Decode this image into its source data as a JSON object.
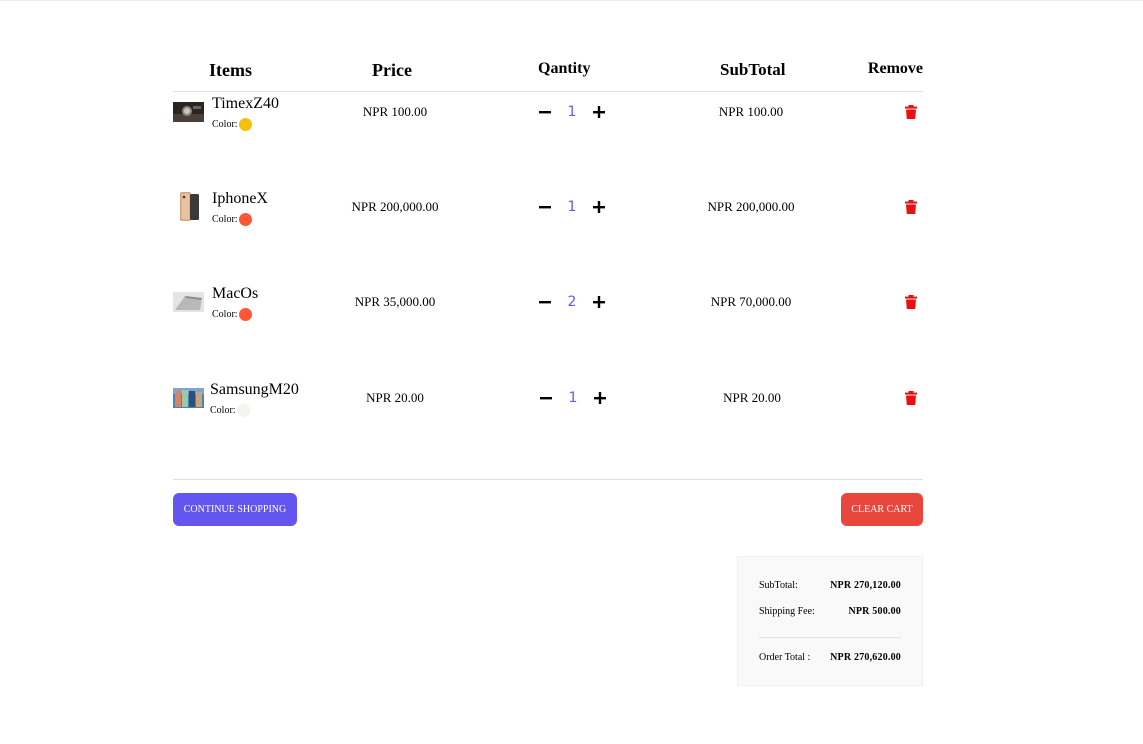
{
  "header": {
    "items": "Items",
    "price": "Price",
    "quantity": "Qantity",
    "subtotal": "SubTotal",
    "remove": "Remove"
  },
  "color_label": "Color:",
  "items": [
    {
      "name": "TimexZ40",
      "color": "#f4c20d",
      "price": "NPR 100.00",
      "qty": "1",
      "subtotal": "NPR 100.00",
      "thumb": "watch"
    },
    {
      "name": "IphoneX",
      "color": "#ff5733",
      "price": "NPR 200,000.00",
      "qty": "1",
      "subtotal": "NPR 200,000.00",
      "thumb": "phone"
    },
    {
      "name": "MacOs",
      "color": "#ff5733",
      "price": "NPR 35,000.00",
      "qty": "2",
      "subtotal": "NPR 70,000.00",
      "thumb": "laptop"
    },
    {
      "name": "SamsungM20",
      "color": "#f5f3ee",
      "price": "NPR 20.00",
      "qty": "1",
      "subtotal": "NPR 20.00",
      "thumb": "samsung"
    }
  ],
  "buttons": {
    "continue": "continue shopping",
    "clear": "clear cart"
  },
  "summary": {
    "subtotal_label": "SubTotal:",
    "subtotal_value": "NPR 270,120.00",
    "shipping_label": "Shipping Fee:",
    "shipping_value": "NPR 500.00",
    "total_label": "Order Total :",
    "total_value": "NPR 270,620.00"
  },
  "colors": {
    "accent": "#6356f0",
    "danger": "#e9463c",
    "trash": "#e81010",
    "qty_value": "#5f5af0"
  }
}
